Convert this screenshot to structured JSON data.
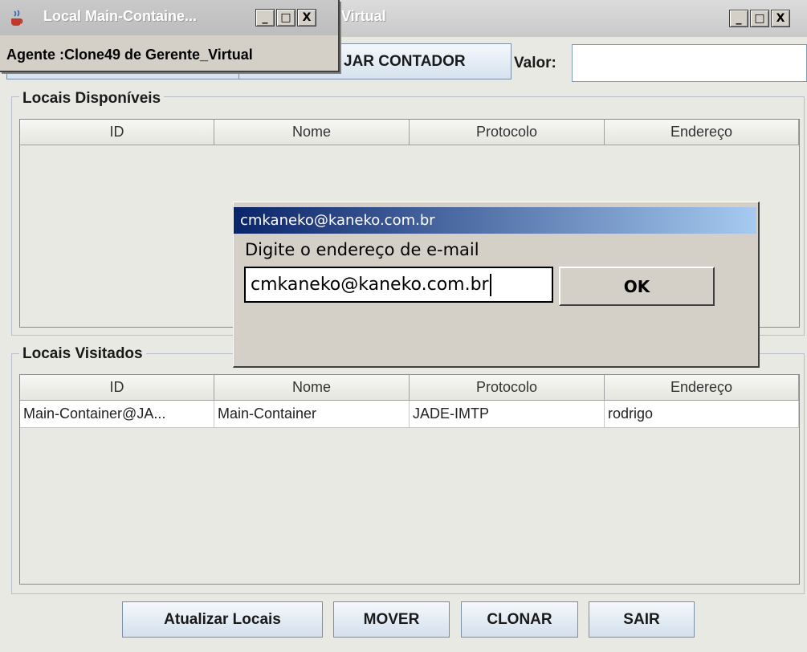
{
  "main_window": {
    "title": "Virtual",
    "buttons": {
      "minimize": "_",
      "maximize": "□",
      "close": "X"
    }
  },
  "agent_window": {
    "title": "Local Main-Containe...",
    "label": "Agente :Clone49 de Gerente_Virtual",
    "buttons": {
      "minimize": "_",
      "maximize": "□",
      "close": "X"
    }
  },
  "toolbar": {
    "contador_label": "JAR CONTADOR",
    "valor_label": "Valor:",
    "valor_value": ""
  },
  "locais_disponiveis": {
    "title": "Locais Disponíveis",
    "columns": [
      "ID",
      "Nome",
      "Protocolo",
      "Endereço"
    ],
    "rows": []
  },
  "locais_visitados": {
    "title": "Locais Visitados",
    "columns": [
      "ID",
      "Nome",
      "Protocolo",
      "Endereço"
    ],
    "rows": [
      [
        "Main-Container@JA...",
        "Main-Container",
        "JADE-IMTP",
        "rodrigo"
      ]
    ]
  },
  "bottom_buttons": {
    "atualizar": "Atualizar Locais",
    "mover": "MOVER",
    "clonar": "CLONAR",
    "sair": "SAIR"
  },
  "dialog": {
    "title": "cmkaneko@kaneko.com.br",
    "prompt": "Digite o endereço de e-mail",
    "input_value": "cmkaneko@kaneko.com.br",
    "ok_label": "OK"
  },
  "colors": {
    "dialog_title_start": "#0a246a",
    "dialog_title_end": "#a6caf0",
    "window_bg": "#e9e9e3"
  }
}
